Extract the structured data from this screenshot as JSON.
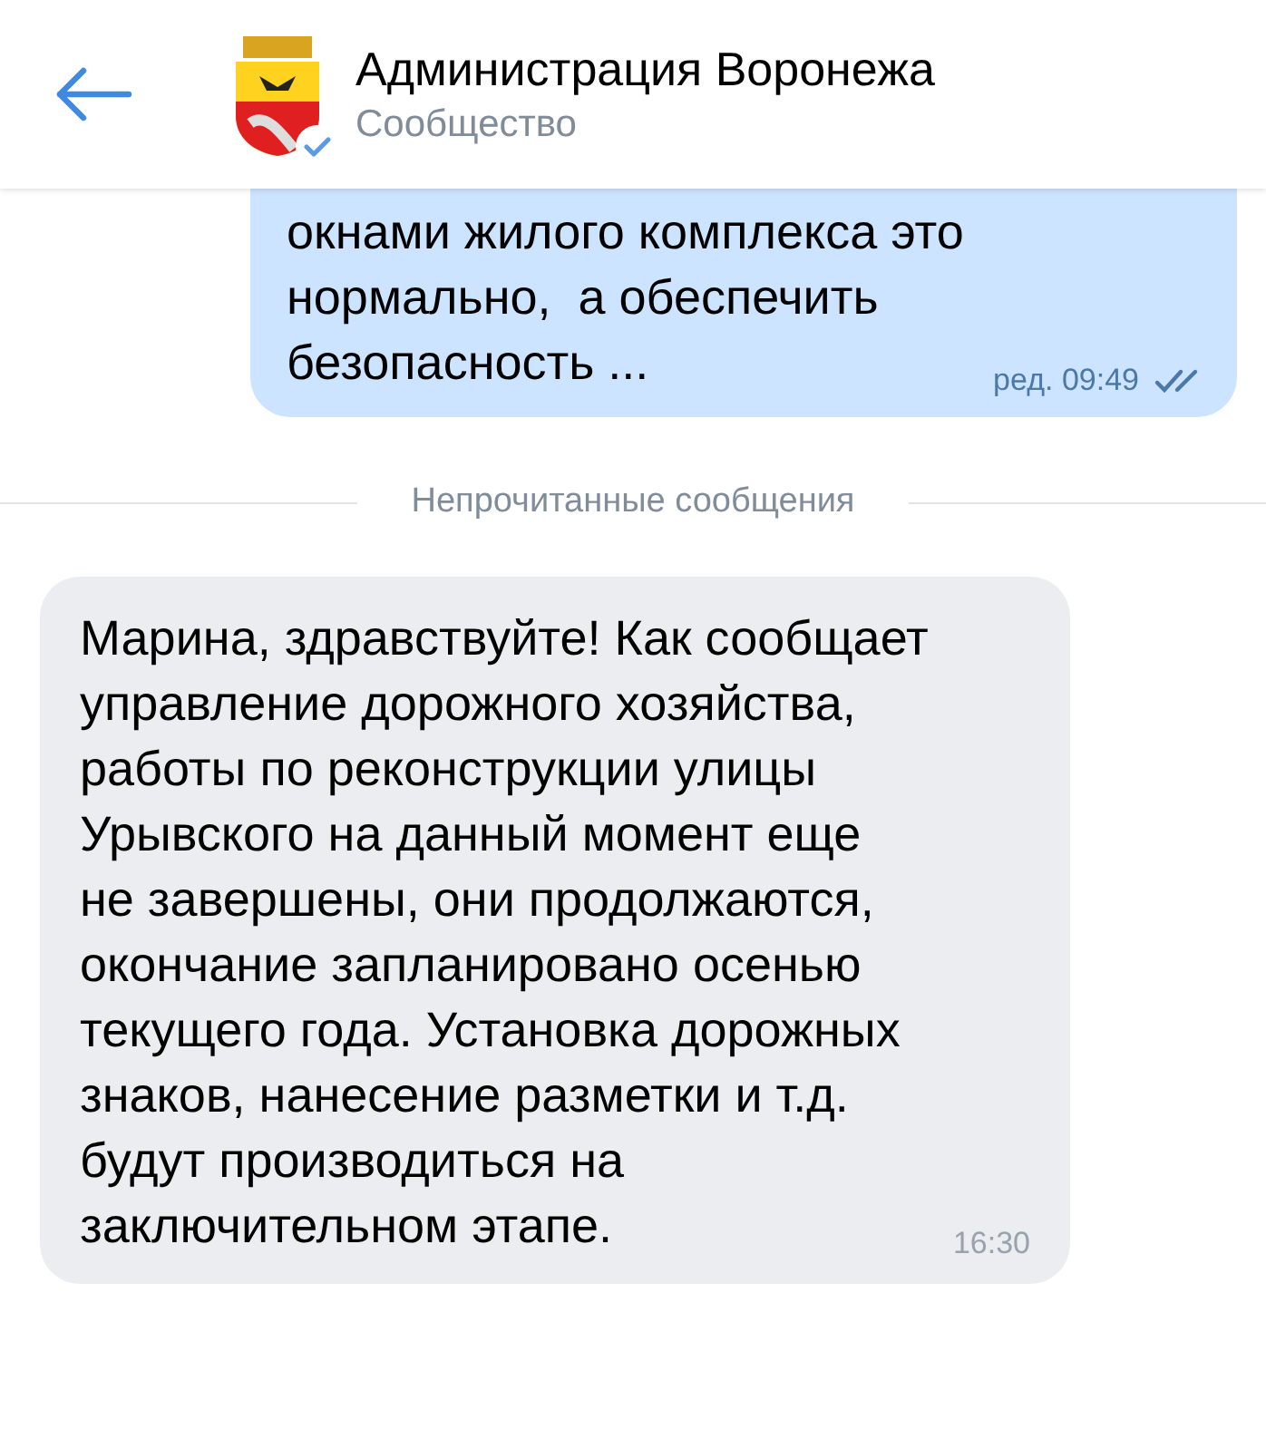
{
  "header": {
    "title": "Администрация Воронежа",
    "subtitle": "Сообщество",
    "verified": true
  },
  "messages": [
    {
      "kind": "outgoing",
      "lines": [
        "окнами жилого комплекса это",
        "нормально,  а обеспечить",
        "безопасность ..."
      ],
      "time": "ред. 09:49",
      "read": true
    },
    {
      "kind": "divider",
      "label": "Непрочитанные сообщения"
    },
    {
      "kind": "incoming",
      "lines": [
        "Марина, здравствуйте! Как сообщает",
        "управление дорожного хозяйства,",
        "работы по реконструкции улицы",
        "Урывского на данный момент еще",
        "не завершены, они продолжаются,",
        "окончание запланировано осенью",
        "текущего года. Установка дорожных",
        "знаков, нанесение разметки и т.д.",
        "будут производиться на",
        "заключительном этапе."
      ],
      "time": "16:30"
    }
  ]
}
